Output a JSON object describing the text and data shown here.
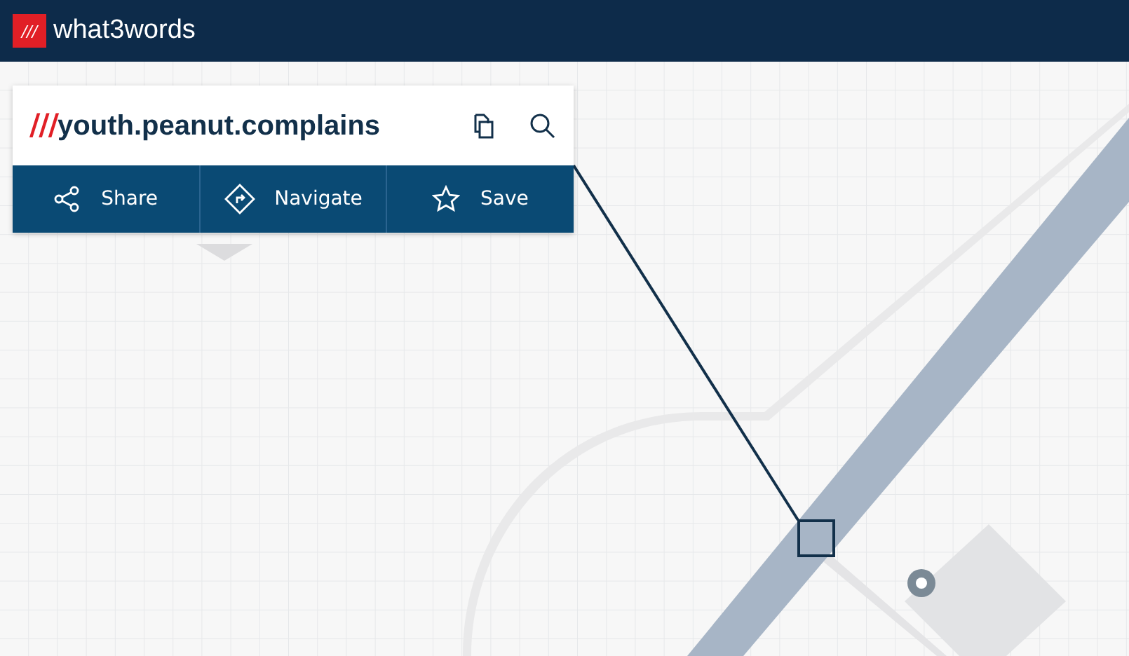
{
  "header": {
    "logo_mark": "///",
    "logo_text": "what3words"
  },
  "address_card": {
    "slashes": "///",
    "words": "youth.peanut.complains"
  },
  "actions": [
    {
      "label": "Share",
      "kind": "share"
    },
    {
      "label": "Navigate",
      "kind": "navigate"
    },
    {
      "label": "Save",
      "kind": "save"
    }
  ]
}
